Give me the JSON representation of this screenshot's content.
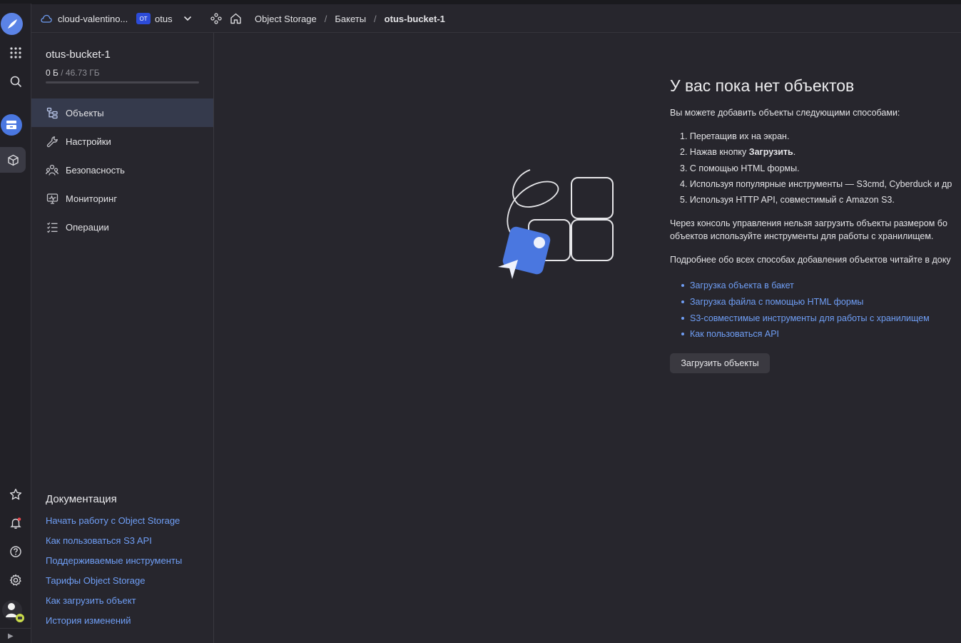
{
  "header": {
    "cloud_name": "cloud-valentino...",
    "folder_badge": "ОТ",
    "folder_name": "otus",
    "breadcrumbs": [
      "Object Storage",
      "Бакеты",
      "otus-bucket-1"
    ],
    "separator": "/"
  },
  "bucket": {
    "name": "otus-bucket-1",
    "used": "0 Б",
    "quota": "/ 46.73 ГБ",
    "usage_fraction": 0
  },
  "nav": [
    {
      "label": "Объекты",
      "icon": "objects-icon",
      "active": true
    },
    {
      "label": "Настройки",
      "icon": "wrench-icon",
      "active": false
    },
    {
      "label": "Безопасность",
      "icon": "users-icon",
      "active": false
    },
    {
      "label": "Мониторинг",
      "icon": "monitor-icon",
      "active": false
    },
    {
      "label": "Операции",
      "icon": "list-icon",
      "active": false
    }
  ],
  "docs": {
    "title": "Документация",
    "links": [
      "Начать работу с Object Storage",
      "Как пользоваться S3 API",
      "Поддерживаемые инструменты",
      "Тарифы Object Storage",
      "Как загрузить объект",
      "История изменений"
    ]
  },
  "empty_state": {
    "title": "У вас пока нет объектов",
    "intro": "Вы можете добавить объекты следующими способами:",
    "steps": [
      {
        "num": "1.",
        "text": "Перетащив их на экран."
      },
      {
        "num": "2.",
        "text": "Нажав кнопку ",
        "bold": "Загрузить",
        "after": "."
      },
      {
        "num": "3.",
        "text": "С помощью HTML формы."
      },
      {
        "num": "4.",
        "text": "Используя популярные инструменты — S3cmd, Cyberduck и др"
      },
      {
        "num": "5.",
        "text": "Используя HTTP API, совместимый с Amazon S3."
      }
    ],
    "size_note_line1": "Через консоль управления нельзя загрузить объекты размером бо",
    "size_note_line2": "объектов используйте инструменты для работы с хранилищем.",
    "docs_note": "Подробнее обо всех способах добавления объектов читайте в доку",
    "links": [
      "Загрузка объекта в бакет",
      "Загрузка файла с помощью HTML формы",
      "S3-совместимые инструменты для работы с хранилищем",
      "Как пользоваться API"
    ],
    "upload_button": "Загрузить объекты"
  },
  "colors": {
    "accent": "#4a77e0",
    "link": "#6f9ef5",
    "background": "#27262d",
    "active_nav": "#353a4c"
  },
  "rail_icons": [
    "logo-icon",
    "apps-grid-icon",
    "search-icon",
    "storage-icon",
    "package-icon",
    "star-icon",
    "bell-icon",
    "help-icon",
    "gear-icon",
    "avatar"
  ]
}
